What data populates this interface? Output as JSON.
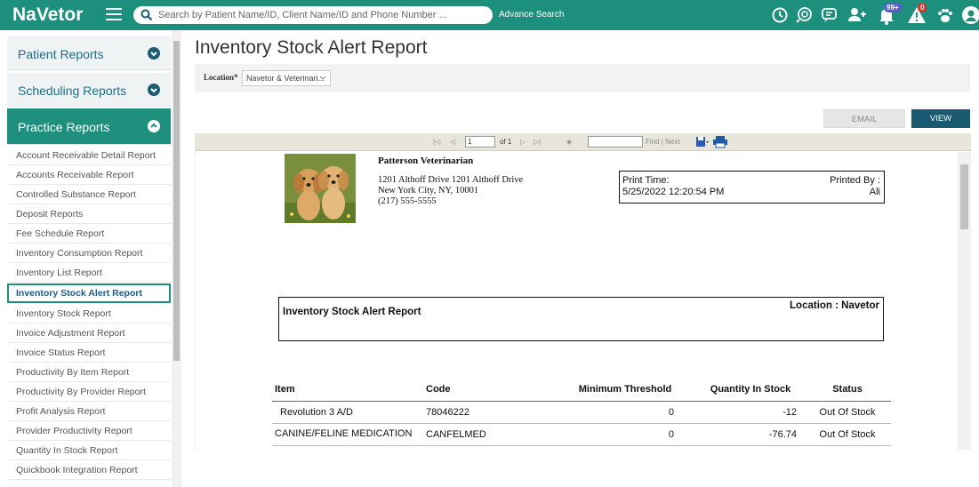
{
  "app": {
    "logo": "NaVetor",
    "search_placeholder": "Search by Patient Name/ID, Client Name/ID and Phone Number ...",
    "advance_search": "Advance Search",
    "icons": [
      "clock-icon",
      "search-chat-icon",
      "messages-icon",
      "add-user-icon",
      "notifications-icon",
      "alerts-icon",
      "paw-icon",
      "profile-icon"
    ],
    "notification_badge": "99+",
    "alert_badge": "0",
    "accent_color": "#1d8f7d"
  },
  "sidebar": {
    "sections": [
      {
        "label": "Patient Reports"
      },
      {
        "label": "Scheduling Reports"
      },
      {
        "label": "Practice Reports"
      }
    ],
    "items": [
      {
        "label": "Account Receivable Detail Report"
      },
      {
        "label": "Accounts Receivable Report"
      },
      {
        "label": "Controlled Substance Report"
      },
      {
        "label": "Deposit Reports"
      },
      {
        "label": "Fee Schedule Report"
      },
      {
        "label": "Inventory Consumption Report"
      },
      {
        "label": "Inventory List Report"
      },
      {
        "label": "Inventory Stock Alert Report"
      },
      {
        "label": "Inventory Stock Report"
      },
      {
        "label": "Invoice Adjustment Report"
      },
      {
        "label": "Invoice Status Report"
      },
      {
        "label": "Productivity By Item Report"
      },
      {
        "label": "Productivity By Provider Report"
      },
      {
        "label": "Profit Analysis Report"
      },
      {
        "label": "Provider Productivity Report"
      },
      {
        "label": "Quantity In Stock Report"
      },
      {
        "label": "Quickbook Integration Report"
      }
    ]
  },
  "main": {
    "title": "Inventory Stock Alert Report",
    "location_label": "Location*",
    "location_value": "Navetor & Veterinari...",
    "email_button": "EMAIL",
    "view_button": "VIEW",
    "toolbar": {
      "page_value": "1",
      "page_of": "of 1",
      "find_next": "Find | Next"
    },
    "report": {
      "clinic_name": "Patterson Veterinarian",
      "address_line": "1201 Althoff Drive 1201 Althoff Drive",
      "city_line": "New York City, NY, 10001",
      "phone": "(217) 555-5555",
      "print_time_label": "Print Time:",
      "print_time_value": "5/25/2022 12:20:54 PM",
      "printed_by_label": "Printed By :",
      "printed_by_value": "Ali",
      "report_title": "Inventory Stock Alert Report",
      "location_text": "Location : Navetor",
      "columns": [
        "Item",
        "Code",
        "Minimum Threshold",
        "Quantity In Stock",
        "Status"
      ],
      "rows": [
        {
          "item": "Revolution 3 A/D",
          "code": "78046222",
          "min": "0",
          "qty": "-12",
          "status": "Out Of Stock"
        },
        {
          "item": "CANINE/FELINE MEDICATION",
          "code": "CANFELMED",
          "min": "0",
          "qty": "-76.74",
          "status": "Out Of Stock"
        }
      ]
    }
  }
}
